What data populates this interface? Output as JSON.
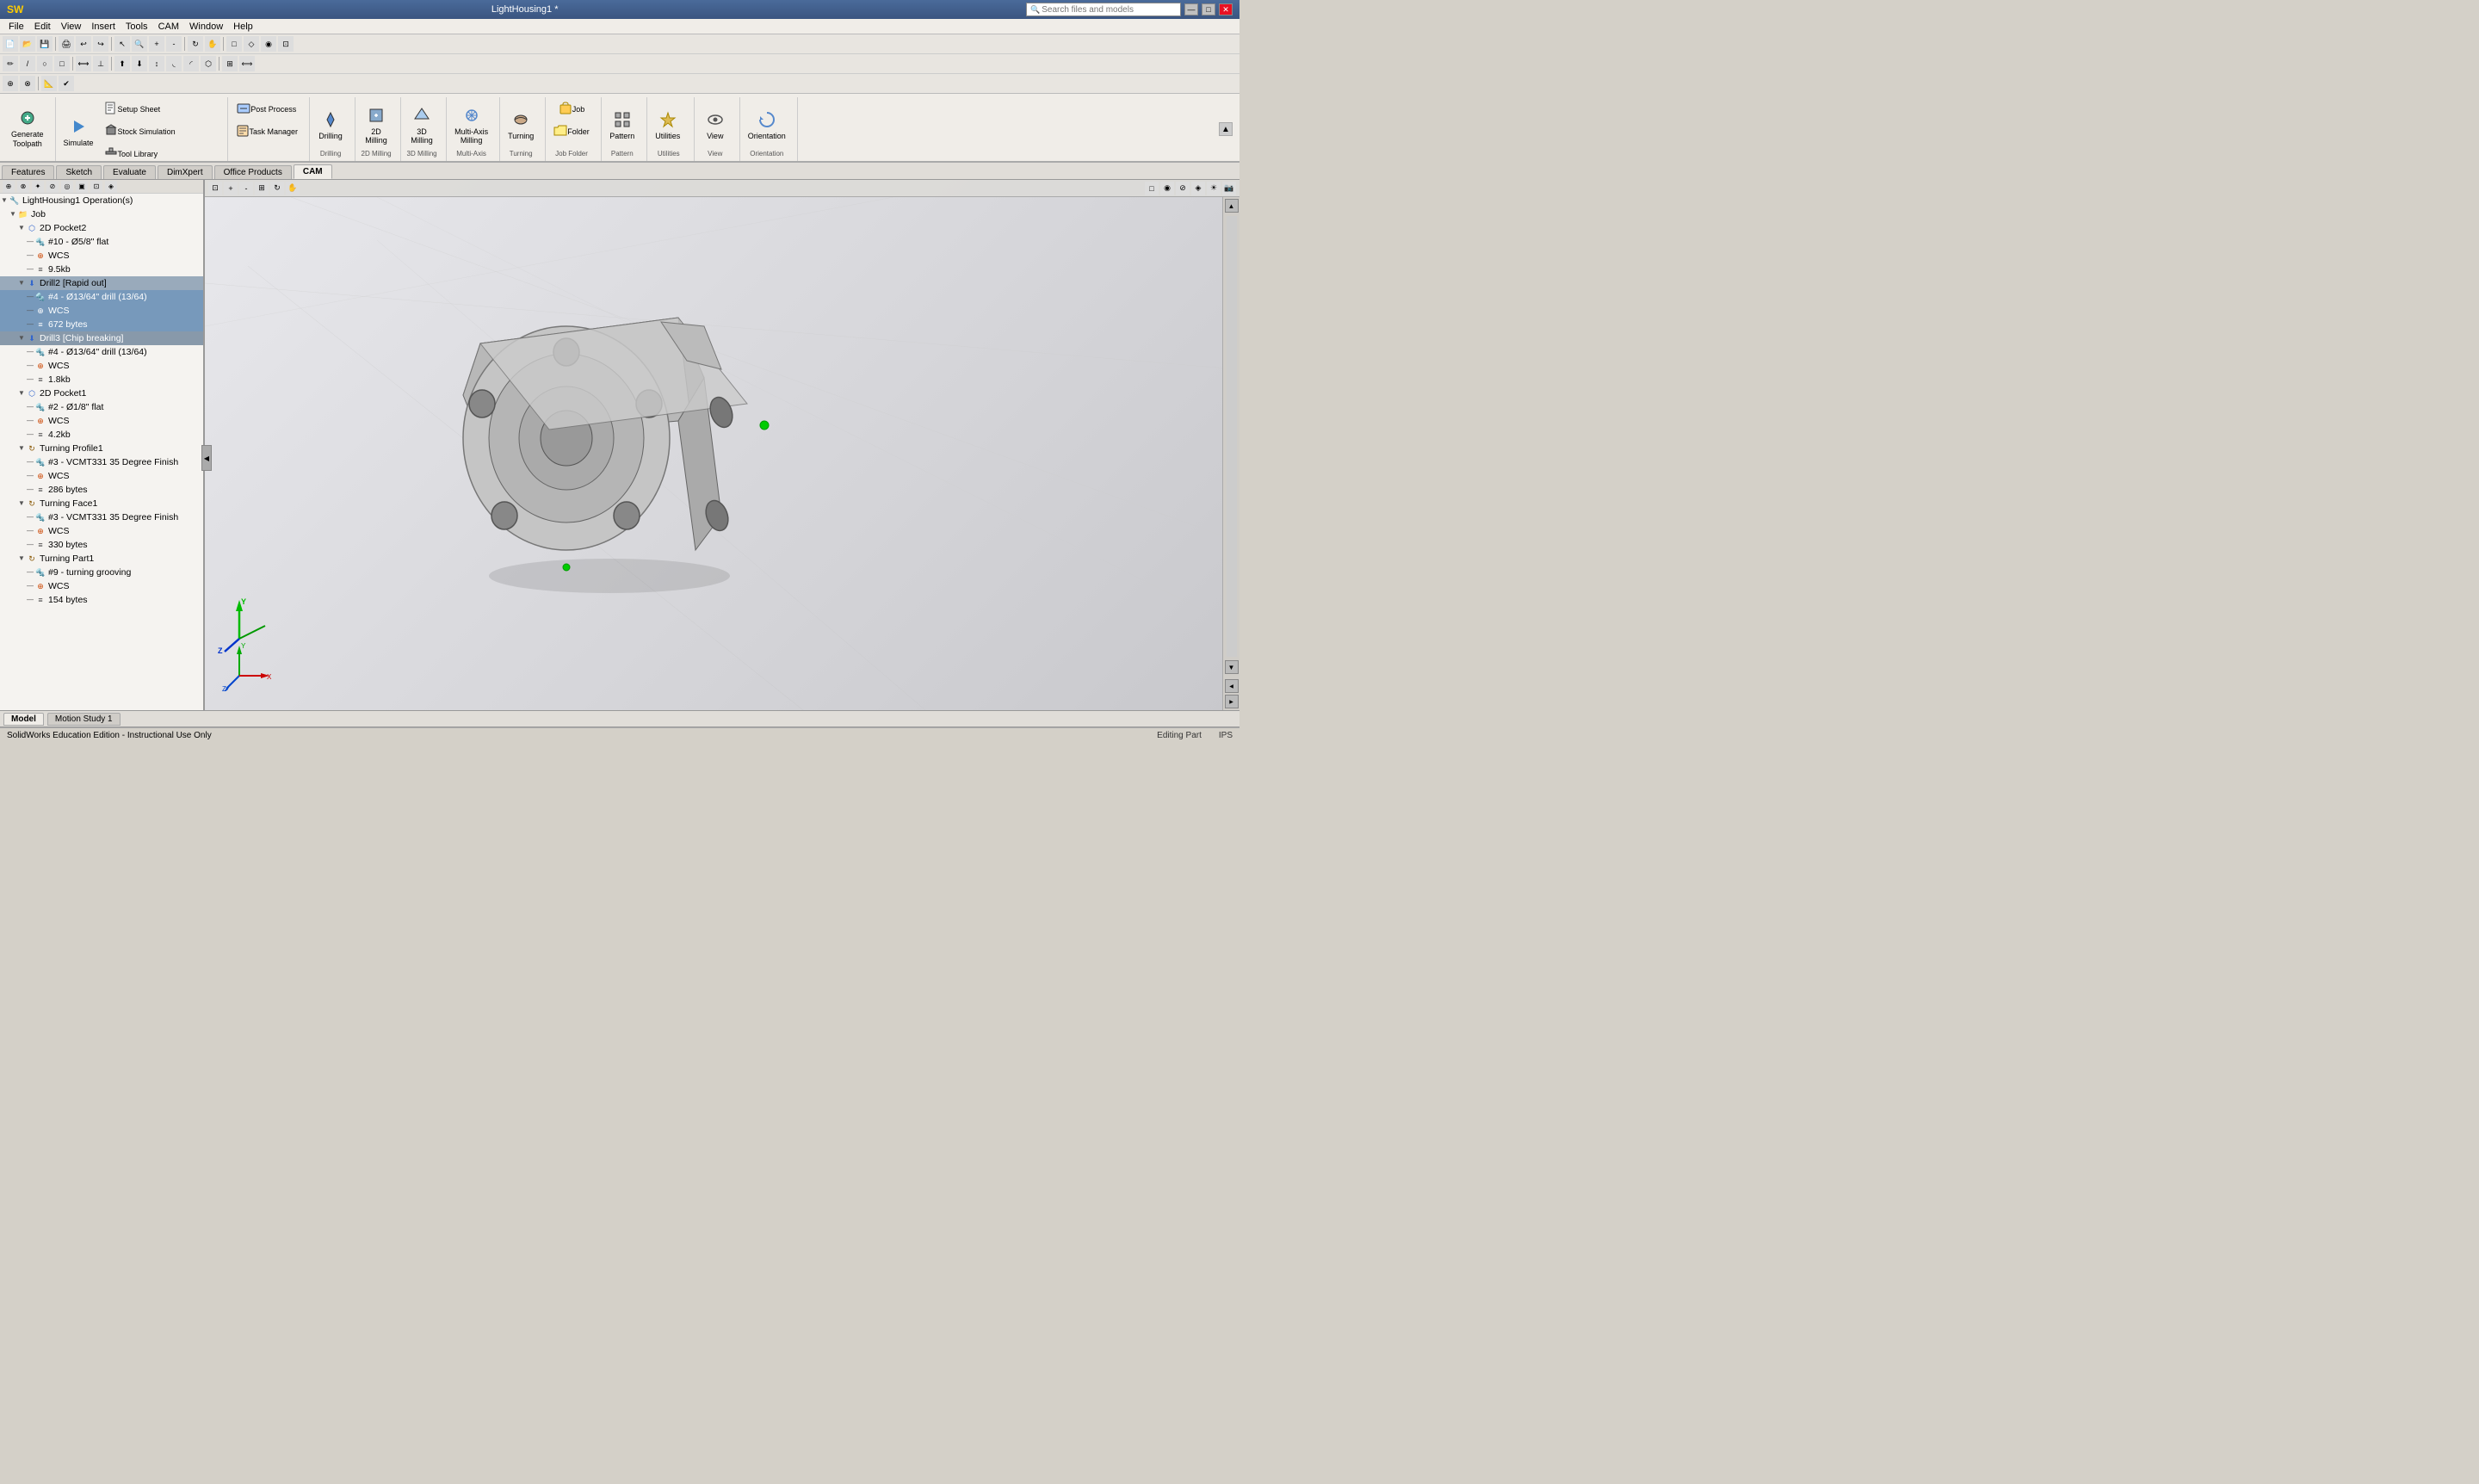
{
  "titlebar": {
    "title": "LightHousing1 *",
    "search_placeholder": "Search files and models",
    "win_minimize": "—",
    "win_restore": "□",
    "win_close": "✕"
  },
  "menubar": {
    "items": [
      "File",
      "Edit",
      "View",
      "Insert",
      "Tools",
      "CAM",
      "Window",
      "Help"
    ]
  },
  "tabs": {
    "items": [
      "Features",
      "Sketch",
      "Evaluate",
      "DimXpert",
      "Office Products",
      "CAM"
    ],
    "active": "CAM"
  },
  "ribbon": {
    "groups": [
      {
        "label": "Generate Toolpath",
        "buttons": [
          {
            "id": "generate",
            "label": "Generate\nToolpath",
            "icon": "gear"
          }
        ]
      },
      {
        "label": "",
        "buttons": [
          {
            "id": "simulate",
            "label": "Simulate",
            "icon": "play"
          },
          {
            "id": "setup-sheet",
            "label": "Setup Sheet",
            "icon": "doc"
          },
          {
            "id": "stock-sim",
            "label": "Stock Simulation",
            "icon": "cube"
          },
          {
            "id": "tool-library",
            "label": "Tool Library",
            "icon": "tools"
          }
        ]
      },
      {
        "label": "",
        "buttons": [
          {
            "id": "post-process",
            "label": "Post Process",
            "icon": "export"
          },
          {
            "id": "task-manager",
            "label": "Task Manager",
            "icon": "tasks"
          }
        ]
      },
      {
        "label": "Drilling",
        "buttons": [
          {
            "id": "drilling",
            "label": "Drilling",
            "icon": "drill"
          }
        ]
      },
      {
        "label": "2D Milling",
        "buttons": [
          {
            "id": "2d-milling",
            "label": "2D\nMilling",
            "icon": "mill2d"
          }
        ]
      },
      {
        "label": "3D Milling",
        "buttons": [
          {
            "id": "3d-milling",
            "label": "3D\nMilling",
            "icon": "mill3d"
          }
        ]
      },
      {
        "label": "Multi-Axis Milling",
        "buttons": [
          {
            "id": "multiaxis",
            "label": "Multi-Axis\nMilling",
            "icon": "multiaxis"
          }
        ]
      },
      {
        "label": "Turning",
        "buttons": [
          {
            "id": "turning",
            "label": "Turning",
            "icon": "turning"
          }
        ]
      },
      {
        "label": "Job Folder",
        "buttons": [
          {
            "id": "job",
            "label": "Job",
            "icon": "job"
          },
          {
            "id": "folder",
            "label": "Folder",
            "icon": "folder"
          }
        ]
      },
      {
        "label": "Pattern",
        "buttons": [
          {
            "id": "pattern",
            "label": "Pattern",
            "icon": "pattern"
          }
        ]
      },
      {
        "label": "Utilities",
        "buttons": [
          {
            "id": "utilities",
            "label": "Utilities",
            "icon": "util"
          }
        ]
      },
      {
        "label": "View",
        "buttons": [
          {
            "id": "view",
            "label": "View",
            "icon": "view"
          }
        ]
      },
      {
        "label": "Orientation",
        "buttons": [
          {
            "id": "orientation",
            "label": "Orientation",
            "icon": "orient"
          }
        ]
      }
    ]
  },
  "tree": {
    "root": "LightHousing1 Operation(s)",
    "items": [
      {
        "id": "job",
        "label": "Job",
        "level": 1,
        "type": "job",
        "expanded": true
      },
      {
        "id": "pocket2",
        "label": "2D Pocket2",
        "level": 2,
        "type": "operation",
        "expanded": true
      },
      {
        "id": "tool-10",
        "label": "#10 - Ø5/8\" flat",
        "level": 3,
        "type": "tool"
      },
      {
        "id": "wcs-1",
        "label": "WCS",
        "level": 3,
        "type": "wcs"
      },
      {
        "id": "size-1",
        "label": "9.5kb",
        "level": 3,
        "type": "size"
      },
      {
        "id": "drill2",
        "label": "Drill2 [Rapid out]",
        "level": 2,
        "type": "operation",
        "expanded": true,
        "highlight": "blue"
      },
      {
        "id": "tool-4a",
        "label": "#4 - Ø13/64\" drill (13/64)",
        "level": 3,
        "type": "tool",
        "highlight": "blue"
      },
      {
        "id": "wcs-2",
        "label": "WCS",
        "level": 3,
        "type": "wcs",
        "highlight": "blue"
      },
      {
        "id": "size-2",
        "label": "672 bytes",
        "level": 3,
        "type": "size",
        "highlight": "blue"
      },
      {
        "id": "drill3",
        "label": "Drill3 [Chip breaking]",
        "level": 2,
        "type": "operation",
        "expanded": true,
        "highlight": "mid"
      },
      {
        "id": "tool-4b",
        "label": "#4 - Ø13/64\" drill (13/64)",
        "level": 3,
        "type": "tool"
      },
      {
        "id": "wcs-3",
        "label": "WCS",
        "level": 3,
        "type": "wcs"
      },
      {
        "id": "size-3",
        "label": "1.8kb",
        "level": 3,
        "type": "size"
      },
      {
        "id": "pocket1",
        "label": "2D Pocket1",
        "level": 2,
        "type": "operation",
        "expanded": true
      },
      {
        "id": "tool-2",
        "label": "#2 - Ø1/8\" flat",
        "level": 3,
        "type": "tool"
      },
      {
        "id": "wcs-4",
        "label": "WCS",
        "level": 3,
        "type": "wcs"
      },
      {
        "id": "size-4",
        "label": "4.2kb",
        "level": 3,
        "type": "size"
      },
      {
        "id": "turning-profile1",
        "label": "Turning Profile1",
        "level": 2,
        "type": "operation",
        "expanded": true
      },
      {
        "id": "tool-3a",
        "label": "#3 - VCMT331 35 Degree Finish",
        "level": 3,
        "type": "tool"
      },
      {
        "id": "wcs-5",
        "label": "WCS",
        "level": 3,
        "type": "wcs"
      },
      {
        "id": "size-5",
        "label": "286 bytes",
        "level": 3,
        "type": "size"
      },
      {
        "id": "turning-face1",
        "label": "Turning Face1",
        "level": 2,
        "type": "operation",
        "expanded": true
      },
      {
        "id": "tool-3b",
        "label": "#3 - VCMT331 35 Degree Finish",
        "level": 3,
        "type": "tool"
      },
      {
        "id": "wcs-6",
        "label": "WCS",
        "level": 3,
        "type": "wcs"
      },
      {
        "id": "size-6",
        "label": "330 bytes",
        "level": 3,
        "type": "size"
      },
      {
        "id": "turning-part1",
        "label": "Turning Part1",
        "level": 2,
        "type": "operation",
        "expanded": true
      },
      {
        "id": "tool-9",
        "label": "#9 - turning grooving",
        "level": 3,
        "type": "tool"
      },
      {
        "id": "wcs-7",
        "label": "WCS",
        "level": 3,
        "type": "wcs"
      },
      {
        "id": "size-7",
        "label": "154 bytes",
        "level": 3,
        "type": "size"
      }
    ]
  },
  "bottom_tabs": {
    "items": [
      "Model",
      "Motion Study 1"
    ],
    "active": "Model"
  },
  "status": {
    "left": "SolidWorks Education Edition - Instructional Use Only",
    "editing": "Editing Part",
    "coord": "IPS"
  },
  "icons": {
    "search": "🔍",
    "gear": "⚙",
    "play": "▶",
    "doc": "📄",
    "cube": "◻",
    "tools": "🔧",
    "export": "↗",
    "tasks": "☰",
    "drill": "⬇",
    "mill": "⬡",
    "job": "📁",
    "folder": "📂",
    "pattern": "⊞",
    "util": "🔨",
    "view": "👁",
    "orient": "↻",
    "expand": "▼",
    "collapse": "▶",
    "arrow_right": "◀"
  }
}
